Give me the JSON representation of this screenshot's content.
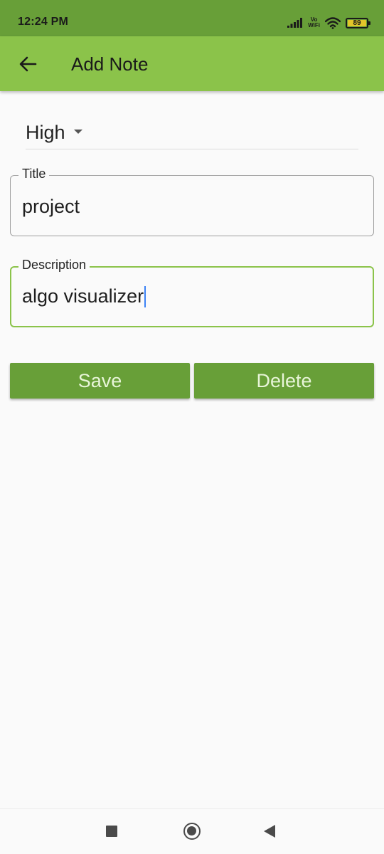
{
  "status_bar": {
    "time": "12:24 PM",
    "vowifi_top": "Vo",
    "vowifi_bottom": "WiFi",
    "battery_level": "89",
    "icons": [
      "signal-icon",
      "vowifi-icon",
      "wifi-icon",
      "battery-icon"
    ]
  },
  "app_bar": {
    "title": "Add Note",
    "back_icon": "arrow-back-icon",
    "color": "#8bc34a"
  },
  "form": {
    "priority": {
      "selected": "High"
    },
    "title_field": {
      "label": "Title",
      "value": "project"
    },
    "description_field": {
      "label": "Description",
      "value": "algo visualizer"
    }
  },
  "actions": {
    "save_label": "Save",
    "delete_label": "Delete",
    "button_color": "#689f38"
  },
  "nav_bar": {
    "icons": [
      "recents-square-icon",
      "home-circle-icon",
      "back-triangle-icon"
    ]
  }
}
